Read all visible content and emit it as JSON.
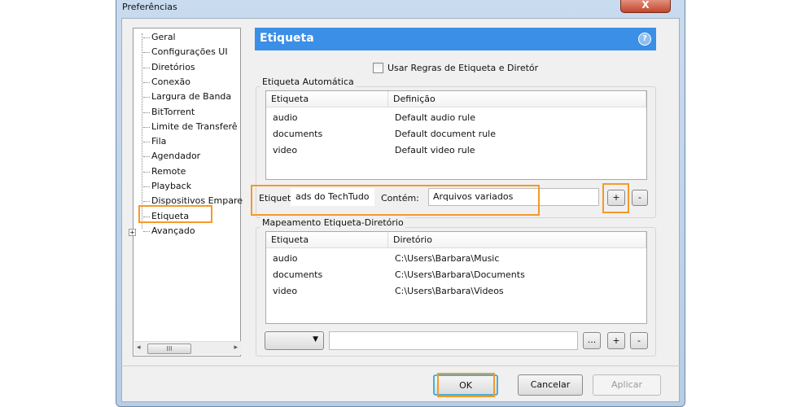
{
  "window": {
    "title": "Preferências",
    "close": "X"
  },
  "tree": {
    "items": [
      "Geral",
      "Configurações UI",
      "Diretórios",
      "Conexão",
      "Largura de Banda",
      "BitTorrent",
      "Limite de Transferê",
      "Fila",
      "Agendador",
      "Remote",
      "Playback",
      "Dispositivos Empare",
      "Etiqueta",
      "Avançado"
    ],
    "selected": "Etiqueta",
    "scroll_thumb": "III"
  },
  "panel": {
    "title": "Etiqueta",
    "help": "?",
    "checkbox_label": "Usar Regras de Etiqueta e Diretór",
    "checkbox_checked": false
  },
  "auto": {
    "group_label": "Etiqueta Automática",
    "columns": [
      "Etiqueta",
      "Definição"
    ],
    "rows": [
      [
        "audio",
        "Default audio rule"
      ],
      [
        "documents",
        "Default document rule"
      ],
      [
        "video",
        "Default video rule"
      ]
    ],
    "label_text": "Etiquet",
    "label_value": "ads do TechTudo",
    "contains_label": "Contém:",
    "contains_value": "Arquivos variados",
    "add": "+",
    "remove": "-"
  },
  "map": {
    "group_label": "Mapeamento Etiqueta-Diretório",
    "columns": [
      "Etiqueta",
      "Diretório"
    ],
    "rows": [
      [
        "audio",
        "C:\\Users\\Barbara\\Music"
      ],
      [
        "documents",
        "C:\\Users\\Barbara\\Documents"
      ],
      [
        "video",
        "C:\\Users\\Barbara\\Videos"
      ]
    ],
    "browse": "...",
    "add": "+",
    "remove": "-",
    "path_value": ""
  },
  "buttons": {
    "ok": "OK",
    "cancel": "Cancelar",
    "apply": "Aplicar"
  },
  "colors": {
    "header": "#3b8fe6",
    "highlight": "#f39a2b"
  }
}
